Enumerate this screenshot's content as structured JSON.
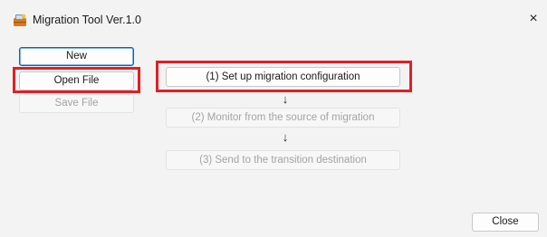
{
  "window": {
    "title": "Migration Tool Ver.1.0",
    "icon": "app-tool-icon",
    "close_glyph": "×"
  },
  "sidebar": {
    "new_label": "New",
    "open_label": "Open File",
    "save_label": "Save File"
  },
  "steps": [
    {
      "label": "(1) Set up migration configuration",
      "enabled": true
    },
    {
      "label": "(2) Monitor from the source of migration",
      "enabled": false
    },
    {
      "label": "(3) Send to the transition destination",
      "enabled": false
    }
  ],
  "arrow_glyph": "↓",
  "footer": {
    "close_label": "Close"
  },
  "colors": {
    "highlight": "#e01f26",
    "accent": "#0067c0",
    "disabled_text": "#a3a3a3"
  }
}
